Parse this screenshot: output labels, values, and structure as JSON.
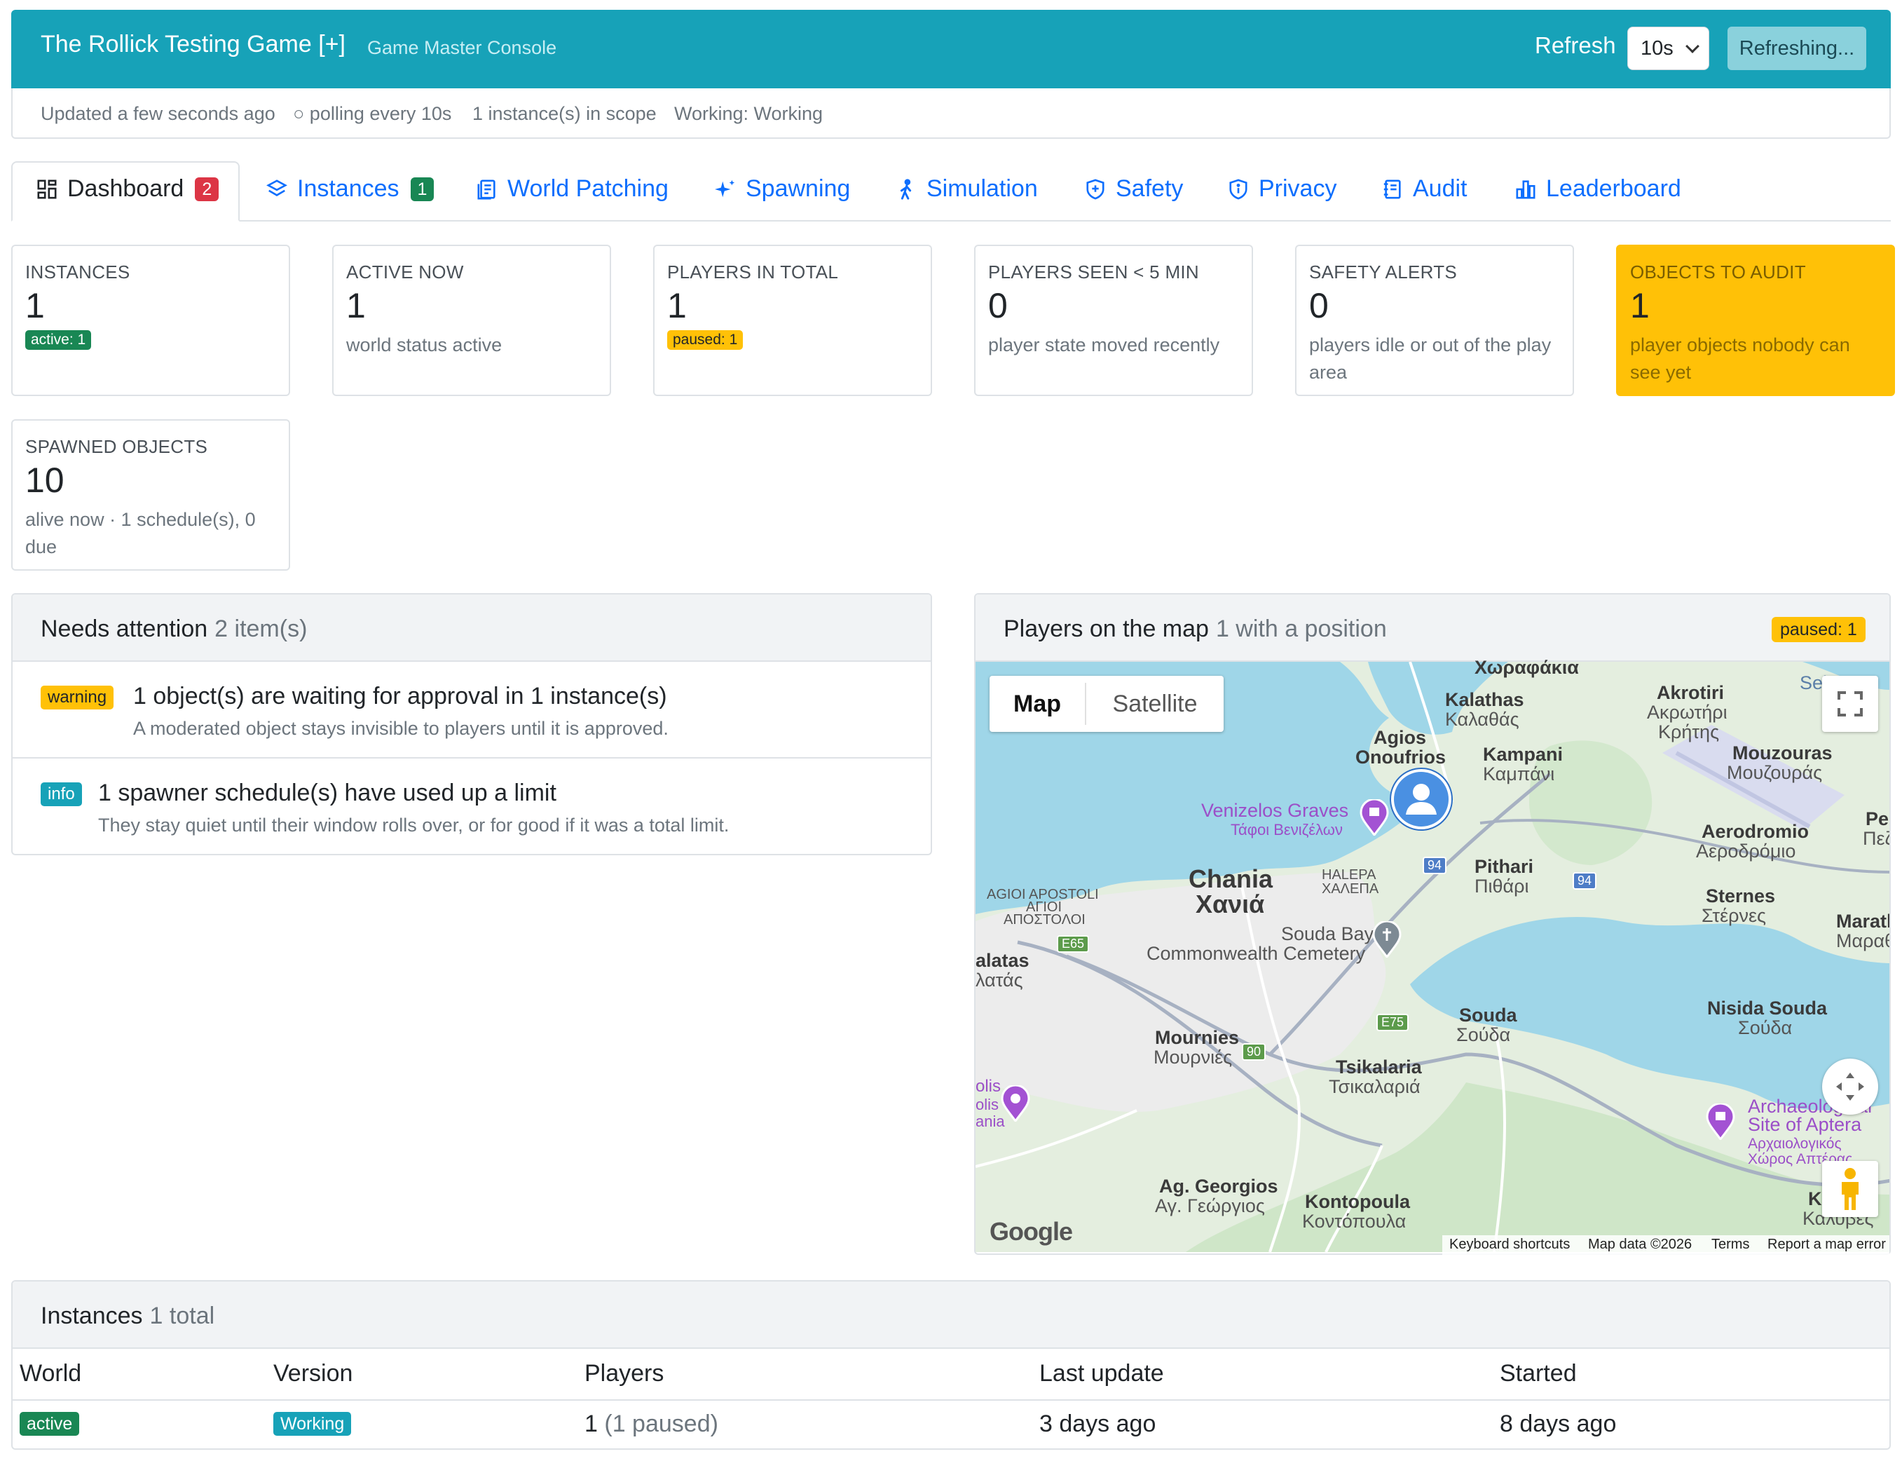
{
  "header": {
    "title": "The Rollick Testing Game [+]",
    "subtitle": "Game Master Console",
    "refresh_label": "Refresh",
    "refresh_interval": "10s",
    "refreshing_button": "Refreshing..."
  },
  "status": {
    "updated": "Updated a few seconds ago",
    "polling": "○ polling every 10s",
    "scope": "1 instance(s) in scope",
    "working": "Working: Working"
  },
  "tabs": [
    {
      "label": "Dashboard",
      "badge": "2",
      "icon": "dashboard-icon",
      "active": true
    },
    {
      "label": "Instances",
      "badge": "1",
      "icon": "layers-icon"
    },
    {
      "label": "World Patching",
      "icon": "document-icon"
    },
    {
      "label": "Spawning",
      "icon": "sparkles-icon"
    },
    {
      "label": "Simulation",
      "icon": "person-walking-icon"
    },
    {
      "label": "Safety",
      "icon": "shield-icon"
    },
    {
      "label": "Privacy",
      "icon": "shield-info-icon"
    },
    {
      "label": "Audit",
      "icon": "journal-icon"
    },
    {
      "label": "Leaderboard",
      "icon": "bar-chart-icon"
    }
  ],
  "cards": [
    {
      "label": "INSTANCES",
      "value": "1",
      "pill": "active: 1"
    },
    {
      "label": "ACTIVE NOW",
      "value": "1",
      "sub": "world status active"
    },
    {
      "label": "PLAYERS IN TOTAL",
      "value": "1",
      "pill": "paused: 1"
    },
    {
      "label": "PLAYERS SEEN < 5 MIN",
      "value": "0",
      "sub": "player state moved recently"
    },
    {
      "label": "SAFETY ALERTS",
      "value": "0",
      "sub": "players idle or out of the play area"
    },
    {
      "label": "OBJECTS TO AUDIT",
      "value": "1",
      "sub": "player objects nobody can see yet"
    },
    {
      "label": "SPAWNED OBJECTS",
      "value": "10",
      "sub": "alive now · 1 schedule(s), 0 due"
    }
  ],
  "attention": {
    "title": "Needs attention",
    "count": "2 item(s)",
    "items": [
      {
        "level": "warning",
        "title": "1 object(s) are waiting for approval in 1 instance(s)",
        "desc": "A moderated object stays invisible to players until it is approved."
      },
      {
        "level": "info",
        "title": "1 spawner schedule(s) have used up a limit",
        "desc": "They stay quiet until their window rolls over, or for good if it was a total limit."
      }
    ]
  },
  "map_panel": {
    "title": "Players on the map",
    "count": "1 with a position",
    "badge": "paused: 1",
    "map_type": {
      "map": "Map",
      "satellite": "Satellite"
    },
    "places": [
      "Χωραφάκια",
      "Kalathas",
      "Καλαθάς",
      "Akrotiri",
      "Ακρωτήρι",
      "Κρήτης",
      "Agios",
      "Onoufrios",
      "Kampani",
      "Καμπάνι",
      "Mouzouras",
      "Μουζουράς",
      "Venizelos Graves",
      "Τάφοι Βενιζέλων",
      "Aerodromio",
      "Αεροδρόμιο",
      "Pithari",
      "Πιθάρι",
      "Chania",
      "Χανιά",
      "HALEPA",
      "ΧΑΛΕΠΑ",
      "AGIOI APOSTOLI",
      "ΑΓΙΟΙ",
      "ΑΠΟΣΤΟΛΟΙ",
      "Sternes",
      "Στέρνες",
      "Souda Bay",
      "Commonwealth Cemetery",
      "alatas",
      "λατάς",
      "Marath",
      "Μαραθ",
      "Souda",
      "Σούδα",
      "Nisida Souda",
      "Σούδα",
      "Mournies",
      "Μουρνιές",
      "Tsikalaria",
      "Τσικαλαριά",
      "Archaeological",
      "Site of Aptera",
      "Αρχαιολογικός",
      "Χώρος Απτέρας",
      "Ag. Georgios",
      "Αγ. Γεώργιος",
      "Kontopoula",
      "Κοντόπουλα",
      "Ka",
      "Καλύβες",
      "Sei",
      "Pe",
      "Πεζ",
      "olis",
      "olis",
      "ania"
    ],
    "road_shields": [
      "94",
      "94",
      "E65",
      "E75",
      "90"
    ],
    "google": "Google",
    "attribution": [
      "Keyboard shortcuts",
      "Map data ©2026",
      "Terms",
      "Report a map error"
    ]
  },
  "instances": {
    "title": "Instances",
    "count": "1 total",
    "columns": [
      "World",
      "Version",
      "Players",
      "Last update",
      "Started"
    ],
    "rows": [
      {
        "world": "active",
        "version": "Working",
        "players": "1",
        "players_paused": "(1 paused)",
        "last_update": "3 days ago",
        "started": "8 days ago"
      }
    ]
  },
  "colors": {
    "header": "#17a2b8",
    "primary": "#0d6efd",
    "success": "#198754",
    "warning": "#ffc107",
    "danger": "#dc3545",
    "info": "#0dcaf0",
    "water": "#9fd6e8",
    "land": "#e6efe2"
  }
}
